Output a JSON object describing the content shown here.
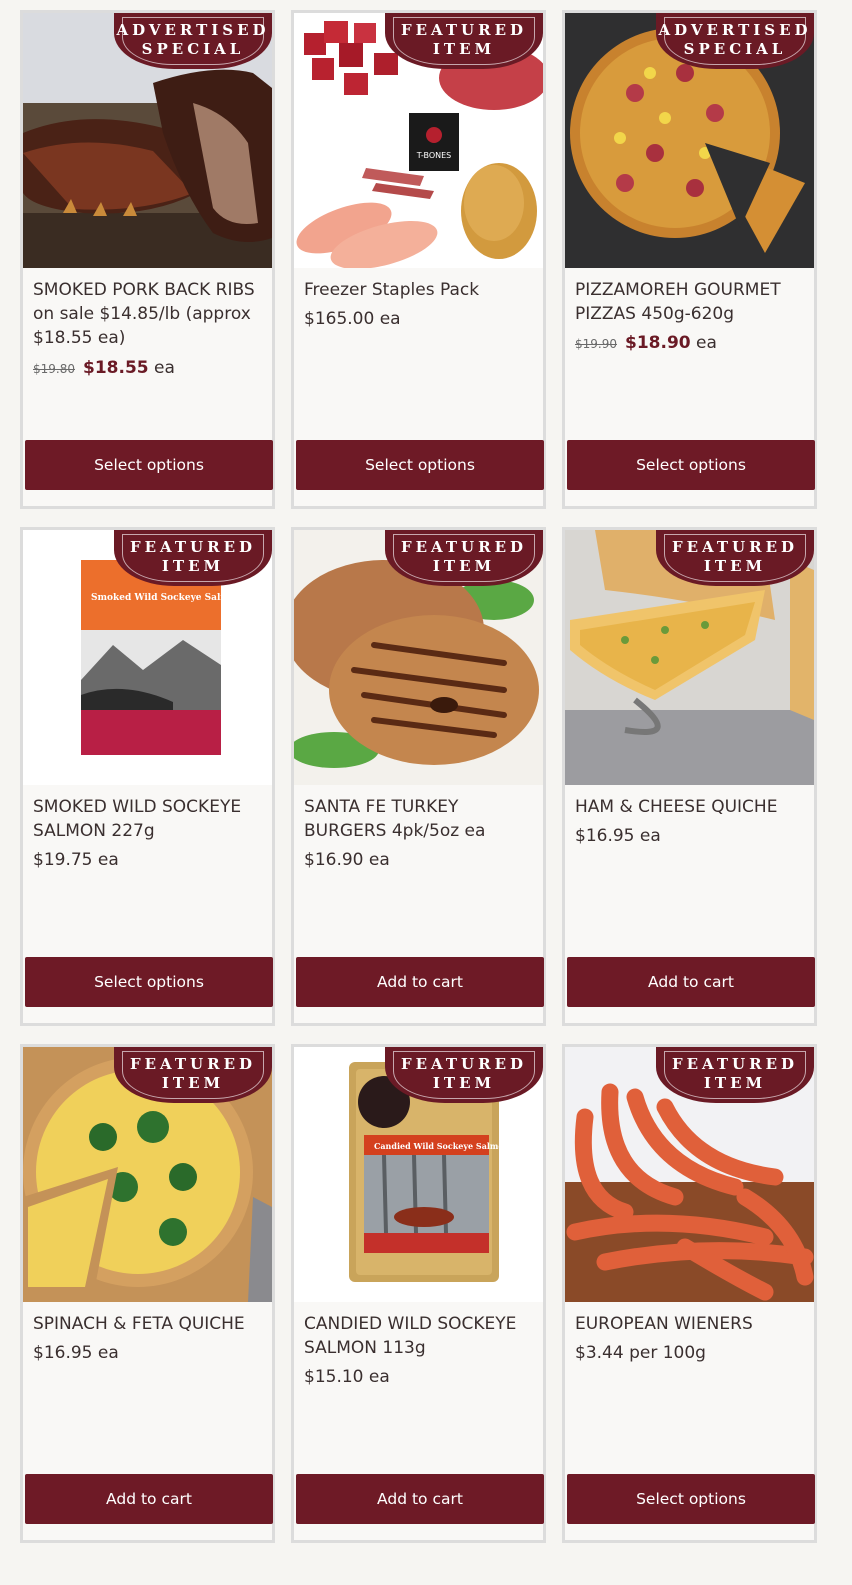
{
  "products": [
    {
      "badge_line1": "ADVERTISED",
      "badge_line2": "SPECIAL",
      "name": "SMOKED PORK BACK RIBS on sale $14.85/lb (approx $18.55 ea)",
      "old_price": "$19.80",
      "sale_price": "$18.55",
      "unit": "ea",
      "button": "Select options"
    },
    {
      "badge_line1": "FEATURED",
      "badge_line2": "ITEM",
      "name": "Freezer Staples Pack",
      "price": "$165.00",
      "unit": "ea",
      "button": "Select options"
    },
    {
      "badge_line1": "ADVERTISED",
      "badge_line2": "SPECIAL",
      "name": "PIZZAMOREH GOURMET PIZZAS 450g-620g",
      "old_price": "$19.90",
      "sale_price": "$18.90",
      "unit": "ea",
      "button": "Select options"
    },
    {
      "badge_line1": "FEATURED",
      "badge_line2": "ITEM",
      "name": "SMOKED WILD SOCKEYE SALMON 227g",
      "price": "$19.75",
      "unit": "ea",
      "button": "Select options"
    },
    {
      "badge_line1": "FEATURED",
      "badge_line2": "ITEM",
      "name": "SANTA FE TURKEY BURGERS 4pk/5oz ea",
      "price": "$16.90",
      "unit": "ea",
      "button": "Add to cart"
    },
    {
      "badge_line1": "FEATURED",
      "badge_line2": "ITEM",
      "name": "HAM & CHEESE QUICHE",
      "price": "$16.95",
      "unit": "ea",
      "button": "Add to cart"
    },
    {
      "badge_line1": "FEATURED",
      "badge_line2": "ITEM",
      "name": "SPINACH & FETA QUICHE",
      "price": "$16.95",
      "unit": "ea",
      "button": "Add to cart"
    },
    {
      "badge_line1": "FEATURED",
      "badge_line2": "ITEM",
      "name": "CANDIED WILD SOCKEYE SALMON 113g",
      "price": "$15.10",
      "unit": "ea",
      "button": "Add to cart"
    },
    {
      "badge_line1": "FEATURED",
      "badge_line2": "ITEM",
      "name": "EUROPEAN WIENERS",
      "price": "$3.44",
      "unit": "per 100g",
      "button": "Select options"
    }
  ],
  "image_labels": {
    "tbones": "T-BONES",
    "salmon_pkg": "Smoked Wild Sockeye Salmon",
    "candied_pkg": "Candied Wild Sockeye Salmon"
  },
  "colors": {
    "brand": "#6e1a26",
    "badge": "#6a1a25",
    "text": "#3a2f2f",
    "border": "#dcdcdc"
  }
}
